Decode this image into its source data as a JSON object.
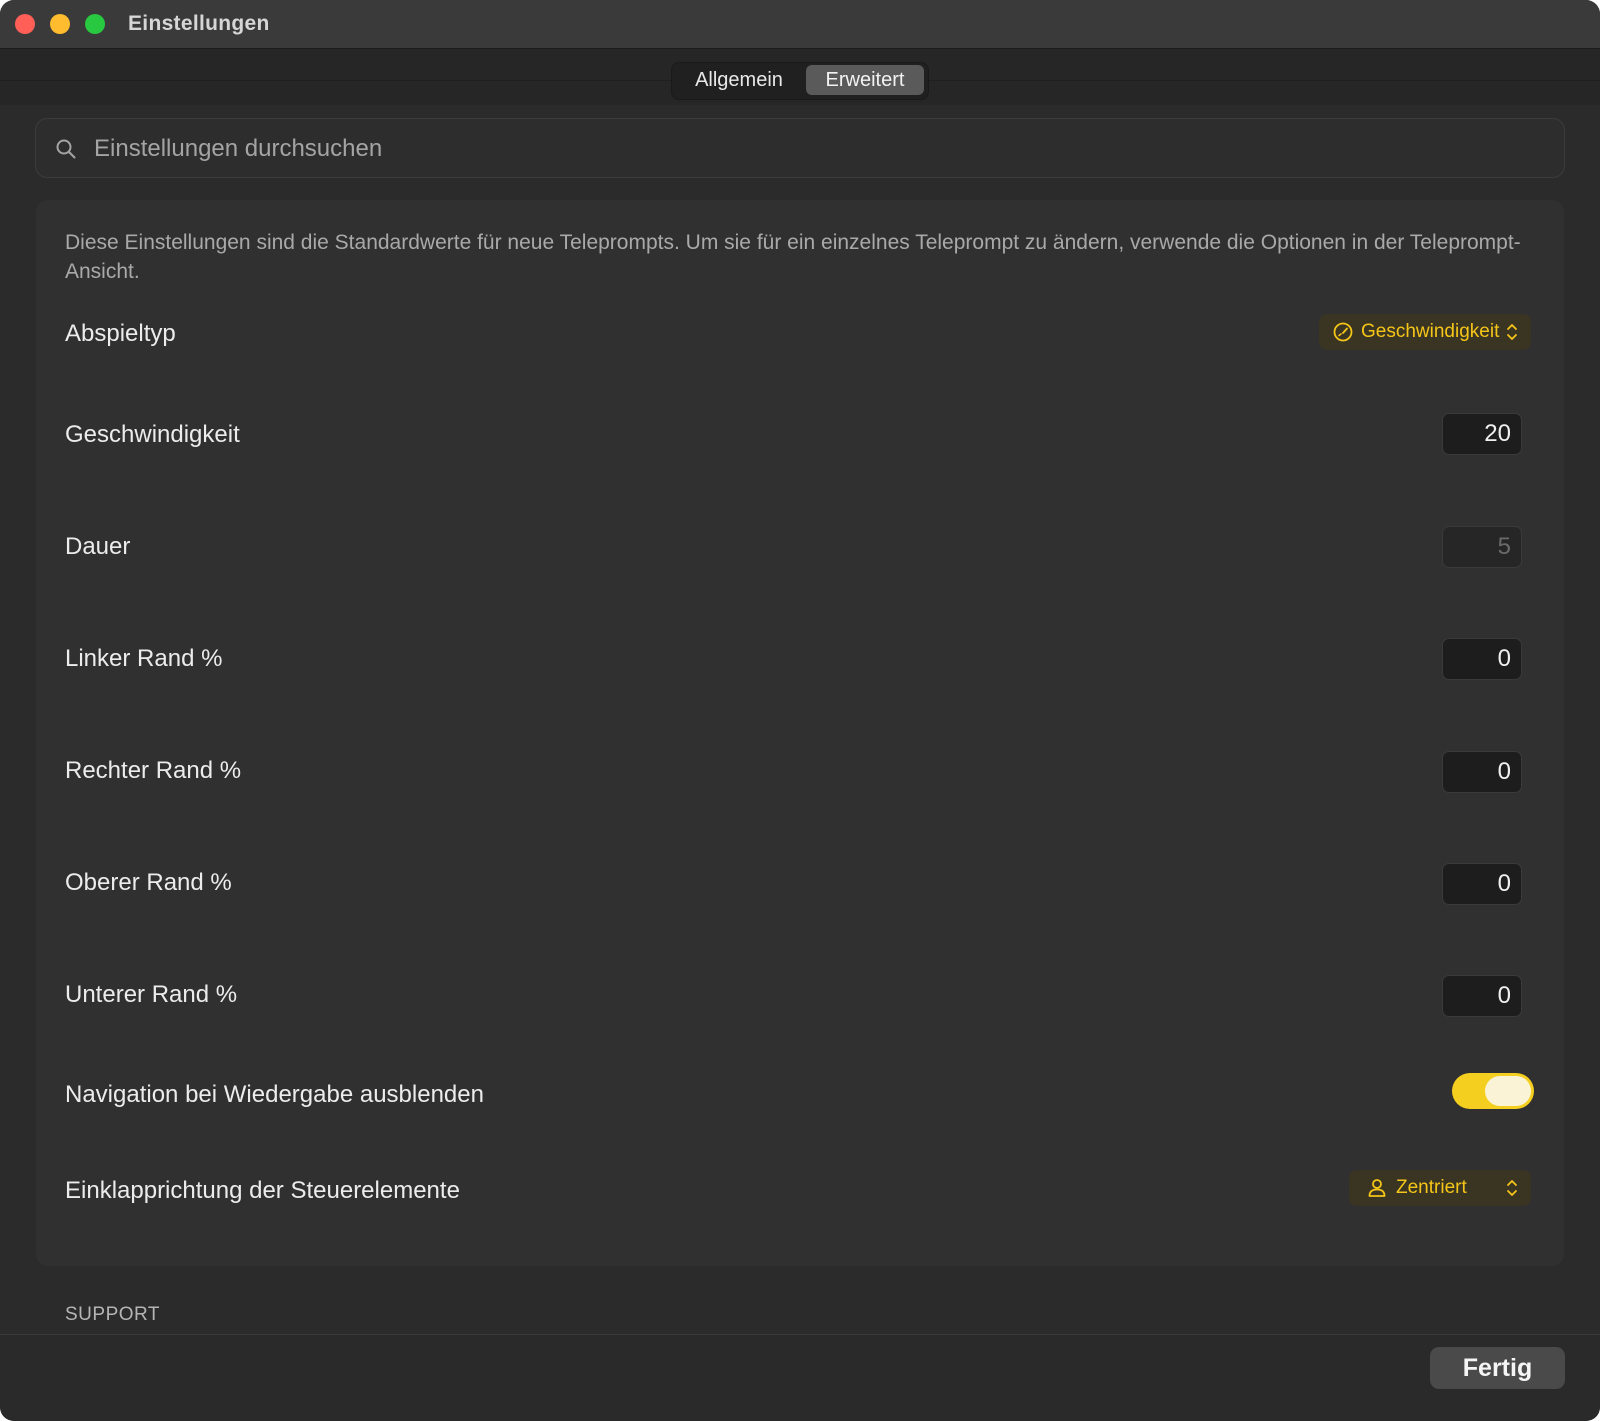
{
  "window": {
    "title": "Einstellungen"
  },
  "tabs": [
    {
      "label": "Allgemein",
      "selected": false
    },
    {
      "label": "Erweitert",
      "selected": true
    }
  ],
  "search": {
    "placeholder": "Einstellungen durchsuchen",
    "value": ""
  },
  "description": "Diese Einstellungen sind die Standardwerte für neue Teleprompts. Um sie für ein einzelnes Teleprompt zu ändern, verwende die Optionen in der Teleprompt-Ansicht.",
  "settings": {
    "playback_type": {
      "label": "Abspieltyp",
      "value": "Geschwindigkeit",
      "icon": "speedometer-icon"
    },
    "speed": {
      "label": "Geschwindigkeit",
      "value": "20"
    },
    "duration": {
      "label": "Dauer",
      "value": "5",
      "disabled": true
    },
    "left_margin": {
      "label": "Linker Rand %",
      "value": "0"
    },
    "right_margin": {
      "label": "Rechter Rand %",
      "value": "0"
    },
    "top_margin": {
      "label": "Oberer Rand %",
      "value": "0"
    },
    "bottom_margin": {
      "label": "Unterer Rand %",
      "value": "0"
    },
    "hide_navigation": {
      "label": "Navigation bei Wiedergabe ausblenden",
      "on": true
    },
    "controls_collapse": {
      "label": "Einklapprichtung der Steuerelemente",
      "value": "Zentriert",
      "icon": "person-icon"
    }
  },
  "support": {
    "header": "SUPPORT"
  },
  "footer": {
    "done_label": "Fertig"
  },
  "colors": {
    "accent": "#f5c518",
    "toggle_on": "#f5cf1f",
    "background": "#2b2b2b",
    "panel": "#303030"
  }
}
